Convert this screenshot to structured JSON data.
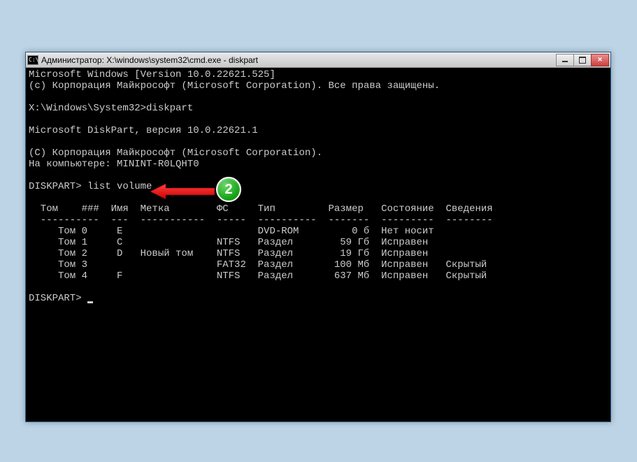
{
  "window": {
    "title": "Администратор: X:\\windows\\system32\\cmd.exe - diskpart"
  },
  "terminal": {
    "line_ms_windows": "Microsoft Windows [Version 10.0.22621.525]",
    "line_copyright": "(c) Корпорация Майкрософт (Microsoft Corporation). Все права защищены.",
    "line_prompt1": "X:\\Windows\\System32>diskpart",
    "line_diskpart_ver": "Microsoft DiskPart, версия 10.0.22621.1",
    "line_corp": "(C) Корпорация Майкрософт (Microsoft Corporation).",
    "line_computer": "На компьютере: MININT-R0LQHT0",
    "line_prompt2": "DISKPART> list volume",
    "table_header": "  Том    ###  Имя  Метка        ФС     Тип         Размер   Состояние  Сведения",
    "table_divider": "  ----------  ---  -----------  -----  ----------  -------  ---------  --------",
    "table_rows": [
      "     Том 0     E                       DVD-ROM         0 б  Нет носит",
      "     Том 1     C                NTFS   Раздел        59 Гб  Исправен",
      "     Том 2     D   Новый том    NTFS   Раздел        19 Гб  Исправен",
      "     Том 3                      FAT32  Раздел       100 Мб  Исправен   Скрытый",
      "     Том 4     F                NTFS   Раздел       637 Мб  Исправен   Скрытый"
    ],
    "line_prompt3": "DISKPART> "
  },
  "annotation": {
    "badge_number": "2"
  }
}
